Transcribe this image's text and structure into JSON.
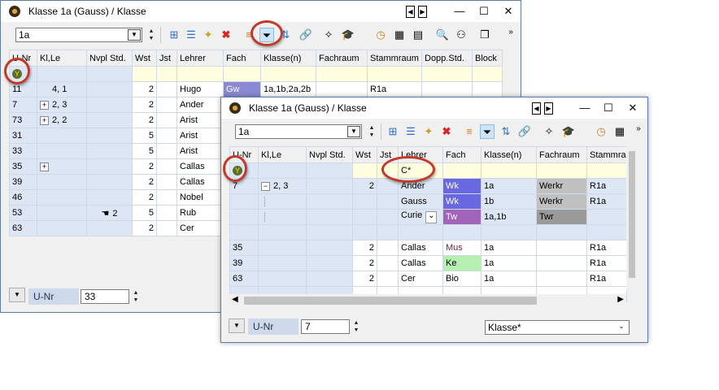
{
  "win1": {
    "title": "Klasse 1a (Gauss) / Klasse",
    "class_combo": "1a",
    "columns": [
      "U-Nr",
      "Kl,Le",
      "Nvpl Std.",
      "Wst",
      "Jst",
      "Lehrer",
      "Fach",
      "Klasse(n)",
      "Fachraum",
      "Stammraum",
      "Dopp.Std.",
      "Block"
    ],
    "rows": [
      {
        "unr": "11",
        "klle": "4, 1",
        "exp": false,
        "nvpl": "",
        "wst": "2",
        "lehrer": "Hugo",
        "fach": "Gw",
        "klassen": "1a,1b,2a,2b",
        "fachraum": "",
        "stammraum": "R1a"
      },
      {
        "unr": "7",
        "klle": "2, 3",
        "exp": true,
        "nvpl": "",
        "wst": "2",
        "lehrer": "Ander",
        "fach": "",
        "klassen": "",
        "fachraum": "",
        "stammraum": ""
      },
      {
        "unr": "73",
        "klle": "2, 2",
        "exp": true,
        "nvpl": "",
        "wst": "2",
        "lehrer": "Arist",
        "fach": "",
        "klassen": "",
        "fachraum": "",
        "stammraum": ""
      },
      {
        "unr": "31",
        "klle": "",
        "exp": false,
        "nvpl": "",
        "wst": "5",
        "lehrer": "Arist",
        "fach": "",
        "klassen": "",
        "fachraum": "",
        "stammraum": ""
      },
      {
        "unr": "33",
        "klle": "",
        "exp": false,
        "nvpl": "",
        "wst": "5",
        "lehrer": "Arist",
        "fach": "",
        "klassen": "",
        "fachraum": "",
        "stammraum": ""
      },
      {
        "unr": "35",
        "klle": "",
        "exp": true,
        "nvpl": "",
        "wst": "2",
        "lehrer": "Callas",
        "fach": "",
        "klassen": "",
        "fachraum": "",
        "stammraum": ""
      },
      {
        "unr": "39",
        "klle": "",
        "exp": false,
        "nvpl": "",
        "wst": "2",
        "lehrer": "Callas",
        "fach": "",
        "klassen": "",
        "fachraum": "",
        "stammraum": ""
      },
      {
        "unr": "46",
        "klle": "",
        "exp": false,
        "nvpl": "",
        "wst": "2",
        "lehrer": "Nobel",
        "fach": "",
        "klassen": "",
        "fachraum": "",
        "stammraum": ""
      },
      {
        "unr": "53",
        "klle": "",
        "exp": false,
        "nvpl": "2",
        "wst": "5",
        "lehrer": "Rub",
        "fach": "",
        "klassen": "",
        "fachraum": "",
        "stammraum": ""
      },
      {
        "unr": "63",
        "klle": "",
        "exp": false,
        "nvpl": "",
        "wst": "2",
        "lehrer": "Cer",
        "fach": "",
        "klassen": "",
        "fachraum": "",
        "stammraum": ""
      }
    ],
    "bottom_label": "U-Nr",
    "bottom_value": "33"
  },
  "win2": {
    "title": "Klasse 1a (Gauss) / Klasse",
    "class_combo": "1a",
    "columns": [
      "U-Nr",
      "Kl,Le",
      "Nvpl Std.",
      "Wst",
      "Jst",
      "Lehrer",
      "Fach",
      "Klasse(n)",
      "Fachraum",
      "Stammrau"
    ],
    "filter_lehrer": "C*",
    "rows": [
      {
        "unr": "7",
        "klle": "2, 3",
        "wst": "2",
        "lehrer": "Ander",
        "fach": "Wk",
        "klassen": "1a",
        "fachraum": "Werkr",
        "stammraum": "R1a"
      },
      {
        "unr": "",
        "klle": "",
        "wst": "",
        "lehrer": "Gauss",
        "fach": "Wk",
        "klassen": "1b",
        "fachraum": "Werkr",
        "stammraum": "R1a"
      },
      {
        "unr": "",
        "klle": "",
        "wst": "",
        "lehrer": "Curie",
        "fach": "Tw",
        "klassen": "1a,1b",
        "fachraum": "Twr",
        "stammraum": ""
      },
      {
        "unr": "35",
        "klle": "",
        "wst": "2",
        "lehrer": "Callas",
        "fach": "Mus",
        "klassen": "1a",
        "fachraum": "",
        "stammraum": "R1a"
      },
      {
        "unr": "39",
        "klle": "",
        "wst": "2",
        "lehrer": "Callas",
        "fach": "Ke",
        "klassen": "1a",
        "fachraum": "",
        "stammraum": "R1a"
      },
      {
        "unr": "63",
        "klle": "",
        "wst": "2",
        "lehrer": "Cer",
        "fach": "Bio",
        "klassen": "1a",
        "fachraum": "",
        "stammraum": "R1a"
      }
    ],
    "bottom_label": "U-Nr",
    "bottom_value": "7",
    "view_combo": "Klasse*"
  },
  "icons": {
    "filter": "Y",
    "expand": "+",
    "collapse": "−"
  }
}
